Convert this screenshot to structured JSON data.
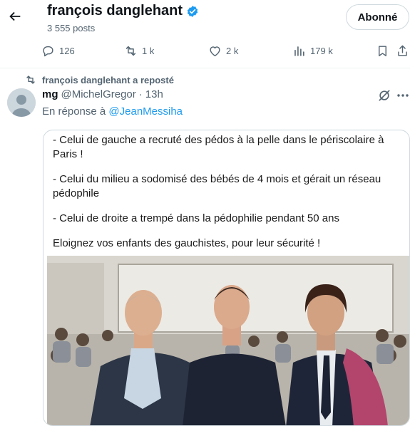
{
  "header": {
    "name": "françois danglehant",
    "posts": "3 555 posts",
    "follow_label": "Abonné"
  },
  "actions": {
    "replies": "126",
    "reposts": "1 k",
    "likes": "2 k",
    "views": "179 k"
  },
  "repost": {
    "text": "françois danglehant a reposté"
  },
  "tweet": {
    "name": "mg",
    "handle": "@MichelGregor",
    "dot": "·",
    "time": "13h",
    "reply_prefix": "En réponse à",
    "reply_mention": "@JeanMessiha"
  },
  "media": {
    "lines": [
      "- Celui de gauche a recruté des pédos à la pelle dans le périscolaire à Paris !",
      "- Celui du milieu a sodomisé des bébés de 4 mois et gérait un réseau pédophile",
      "- Celui de droite a trempé dans la pédophilie pendant 50 ans",
      "Eloignez vos enfants des gauchistes, pour leur sécurité !"
    ]
  },
  "colors": {
    "accent": "#1d9bf0",
    "muted": "#536471",
    "border": "#cfd9de"
  },
  "icons": [
    "back-arrow-icon",
    "verified-badge-icon",
    "reply-icon",
    "repost-icon",
    "like-icon",
    "views-icon",
    "bookmark-icon",
    "share-icon",
    "grok-icon",
    "more-icon"
  ]
}
